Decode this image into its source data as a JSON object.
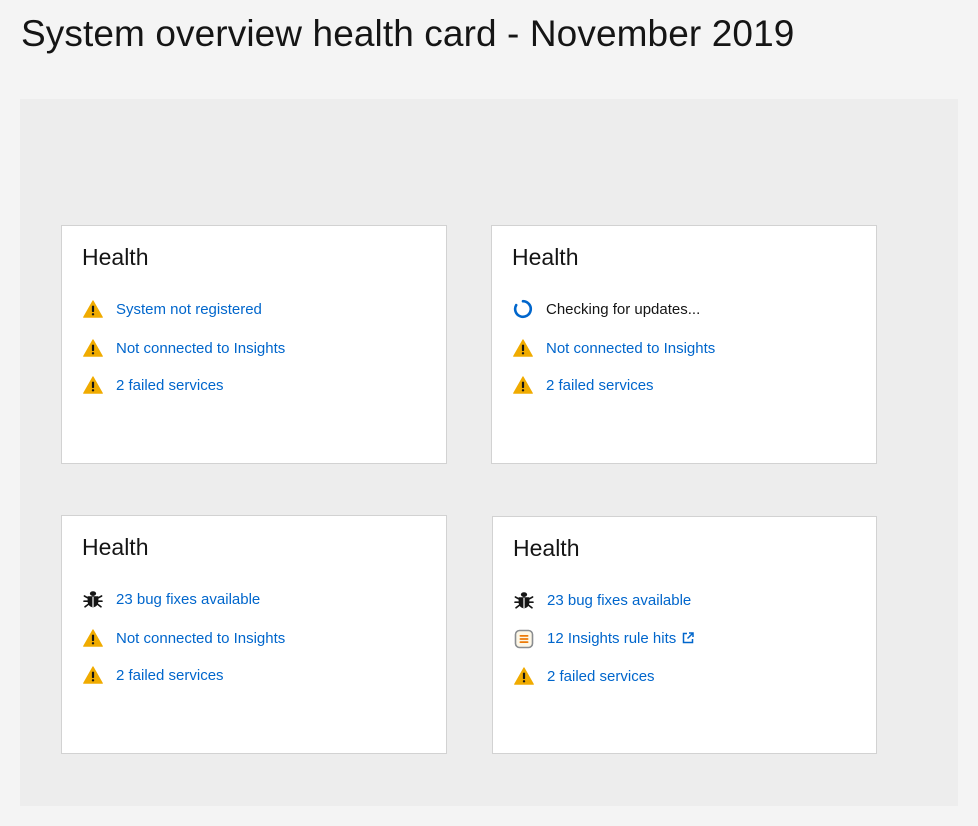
{
  "page": {
    "title": "System overview health card - November 2019"
  },
  "colors": {
    "warning": "#f0ab00",
    "link": "#0066cc",
    "spinner": "#0066cc",
    "bug": "#151515",
    "insights": "#ec7a08"
  },
  "cards": [
    {
      "title": "Health",
      "items": [
        {
          "icon": "warning-icon",
          "label": "System not registered",
          "link": true
        },
        {
          "icon": "warning-icon",
          "label": "Not connected to Insights",
          "link": true
        },
        {
          "icon": "warning-icon",
          "label": "2 failed services",
          "link": true
        }
      ]
    },
    {
      "title": "Health",
      "items": [
        {
          "icon": "spinner-icon",
          "label": "Checking for updates...",
          "link": false
        },
        {
          "icon": "warning-icon",
          "label": "Not connected to Insights",
          "link": true
        },
        {
          "icon": "warning-icon",
          "label": "2 failed services",
          "link": true
        }
      ]
    },
    {
      "title": "Health",
      "items": [
        {
          "icon": "bug-icon",
          "label": "23 bug fixes available",
          "link": true
        },
        {
          "icon": "warning-icon",
          "label": "Not connected to Insights",
          "link": true
        },
        {
          "icon": "warning-icon",
          "label": "2 failed services",
          "link": true
        }
      ]
    },
    {
      "title": "Health",
      "items": [
        {
          "icon": "bug-icon",
          "label": "23 bug fixes available",
          "link": true
        },
        {
          "icon": "insights-icon",
          "label": "12 Insights rule hits",
          "link": true,
          "external": true
        },
        {
          "icon": "warning-icon",
          "label": "2 failed services",
          "link": true
        }
      ]
    }
  ]
}
